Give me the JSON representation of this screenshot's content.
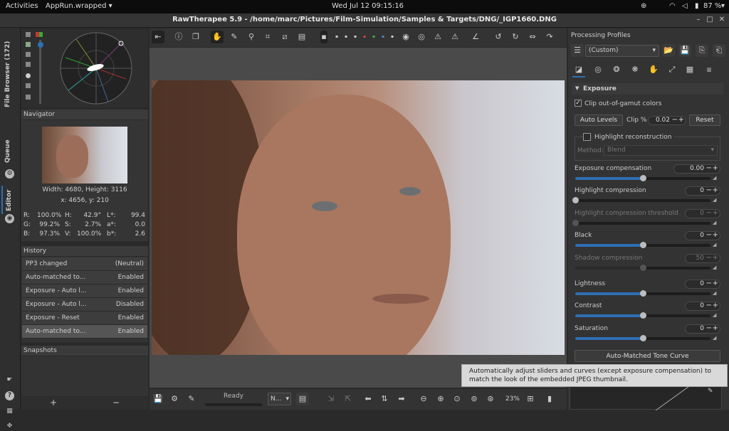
{
  "topbar": {
    "activities": "Activities",
    "app": "AppRun.wrapped ▾",
    "clock": "Wed Jul 12  09:15:16",
    "battery": "87 %"
  },
  "window": {
    "title": "RawTherapee 5.9 - /home/marc/Pictures/Film-Simulation/Samples & Targets/DNG/_IGP1660.DNG"
  },
  "vtabs": {
    "file_browser": "File Browser (172)",
    "queue": "Queue",
    "editor": "Editor"
  },
  "navigator": {
    "title": "Navigator",
    "size": "Width: 4680, Height: 3116",
    "coords": "x: 4656, y: 210",
    "r_label": "R:",
    "r": "100.0%",
    "g_label": "G:",
    "g": "99.2%",
    "b_label": "B:",
    "b": "97.3%",
    "h_label": "H:",
    "h": "42.9°",
    "s_label": "S:",
    "s": "2.7%",
    "v_label": "V:",
    "v": "100.0%",
    "l_label": "L*:",
    "l": "99.4",
    "a_label": "a*:",
    "a": "0.0",
    "bb_label": "b*:",
    "bb": "2.6"
  },
  "history": {
    "title": "History",
    "rows": [
      {
        "action": "PP3 changed",
        "value": "(Neutral)"
      },
      {
        "action": "Auto-matched to...",
        "value": "Enabled"
      },
      {
        "action": "Exposure - Auto l...",
        "value": "Enabled"
      },
      {
        "action": "Exposure - Auto l...",
        "value": "Disabled"
      },
      {
        "action": "Exposure - Reset",
        "value": "Enabled"
      },
      {
        "action": "Auto-matched to...",
        "value": "Enabled"
      }
    ]
  },
  "snapshots": {
    "title": "Snapshots",
    "add": "+",
    "remove": "−"
  },
  "bottom": {
    "status": "Ready",
    "mode": "N...",
    "zoom": "23%"
  },
  "profiles": {
    "title": "Processing Profiles",
    "selected": "(Custom)"
  },
  "exposure": {
    "title": "Exposure",
    "clip_label": "Clip out-of-gamut colors",
    "auto_levels": "Auto Levels",
    "clip_pct_label": "Clip %",
    "clip_pct": "0.02",
    "reset": "Reset",
    "hl_recon": "Highlight reconstruction",
    "method_label": "Method:",
    "method": "Blend",
    "sliders": [
      {
        "label": "Exposure compensation",
        "value": "0.00",
        "pos": 0.5,
        "dim": false
      },
      {
        "label": "Highlight compression",
        "value": "0",
        "pos": 0.0,
        "dim": false
      },
      {
        "label": "Highlight compression threshold",
        "value": "0",
        "pos": 0.0,
        "dim": true
      },
      {
        "label": "Black",
        "value": "0",
        "pos": 0.5,
        "dim": false
      },
      {
        "label": "Shadow compression",
        "value": "50",
        "pos": 0.5,
        "dim": true
      },
      {
        "label": "Lightness",
        "value": "0",
        "pos": 0.5,
        "dim": false
      },
      {
        "label": "Contrast",
        "value": "0",
        "pos": 0.5,
        "dim": false
      },
      {
        "label": "Saturation",
        "value": "0",
        "pos": 0.5,
        "dim": false
      }
    ],
    "tone_curve": "Auto-Matched Tone Curve"
  },
  "tooltip": {
    "text": "Automatically adjust sliders and curves (except exposure compensation) to match the look of the embedded JPEG thumbnail."
  },
  "colors": {
    "accent": "#2f6fb4",
    "bg": "#2a2a2a"
  }
}
